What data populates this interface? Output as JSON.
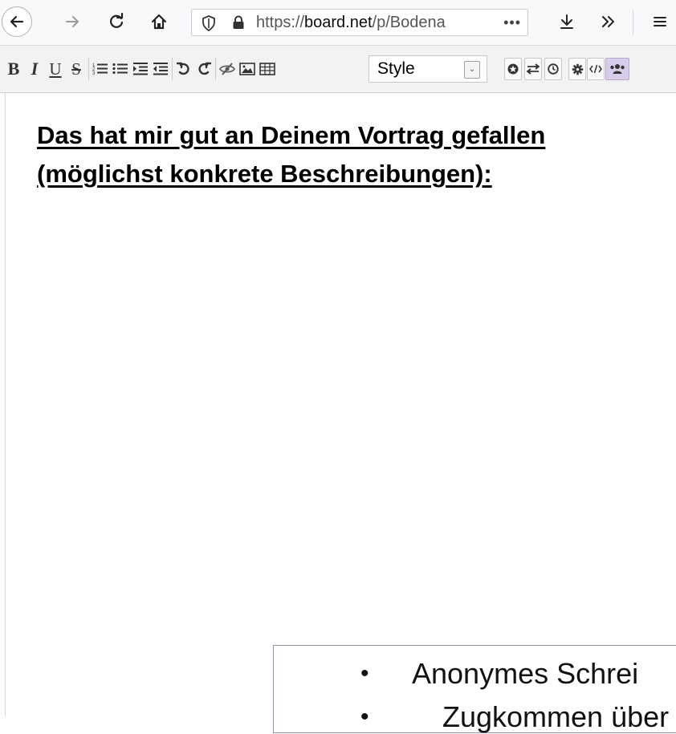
{
  "browser": {
    "url_prefix": "https://",
    "url_domain": "board.net",
    "url_path": "/p/Bodena",
    "url_more": "•••"
  },
  "toolbar": {
    "bold": "B",
    "italic": "I",
    "underline": "U",
    "strike": "S",
    "style_select_value": "Style"
  },
  "document": {
    "heading_line1": "Das hat mir gut an Deinem Vortrag gefallen",
    "heading_line2": "(möglichst konkrete Beschreibungen):"
  },
  "overlay": {
    "bullet_glyph": "•",
    "bullet1": "Anonymes Schrei",
    "bullet2": "Zugkommen über"
  },
  "colors": {
    "toolbar_bg": "#f2f2f2",
    "navbar_bg": "#f9f9fb",
    "page_bg": "#ffffff"
  }
}
